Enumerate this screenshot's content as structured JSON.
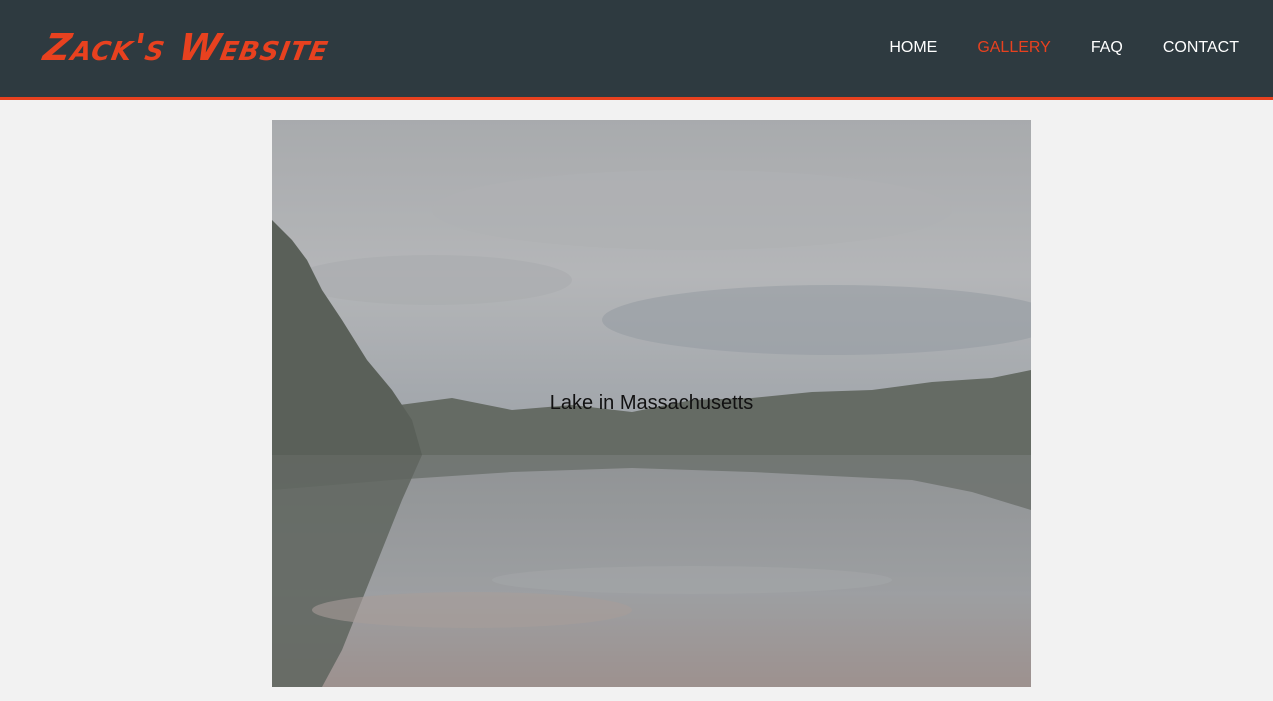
{
  "header": {
    "logo": "Zack's Website",
    "nav": [
      {
        "label": "HOME",
        "active": false
      },
      {
        "label": "GALLERY",
        "active": true
      },
      {
        "label": "FAQ",
        "active": false
      },
      {
        "label": "CONTACT",
        "active": false
      }
    ]
  },
  "gallery": {
    "caption": "Lake in Massachusetts"
  },
  "colors": {
    "header_bg": "#2e3a40",
    "accent": "#e8411f",
    "page_bg": "#f2f2f2"
  }
}
